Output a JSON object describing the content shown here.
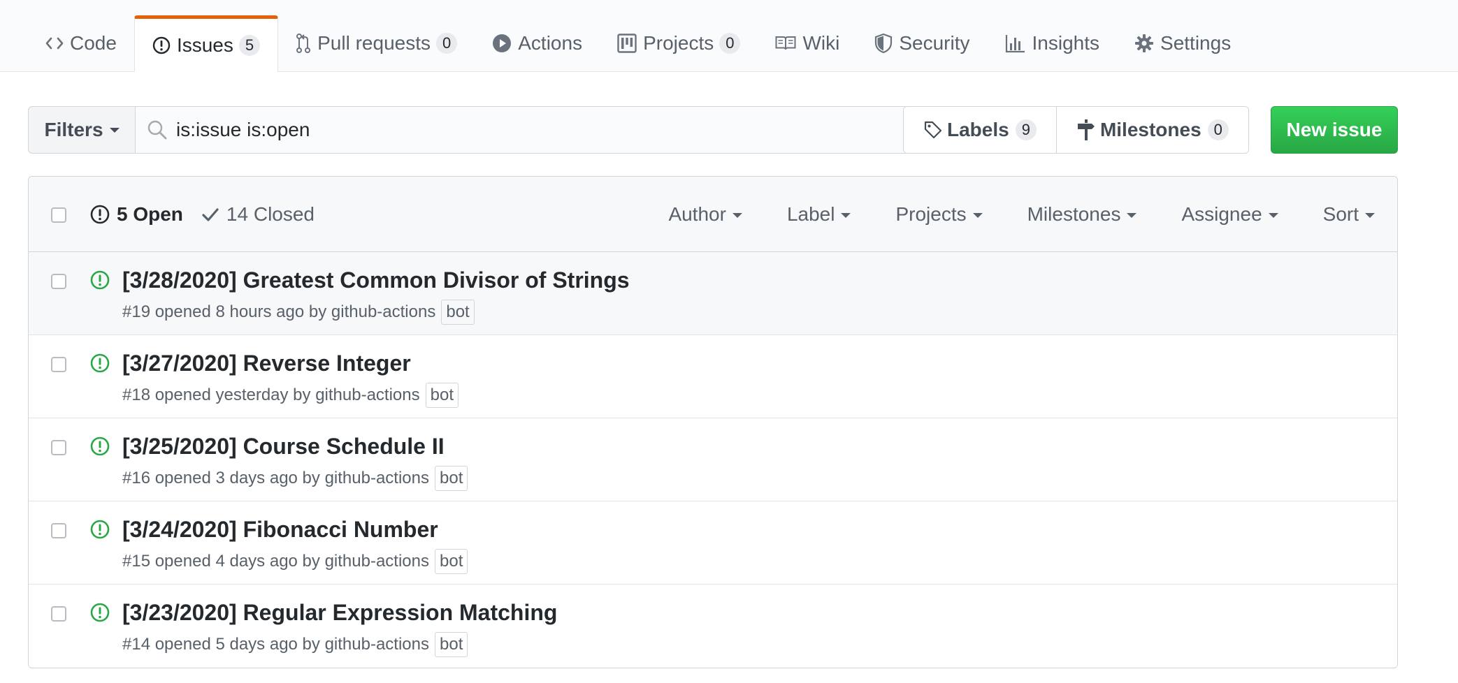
{
  "nav": {
    "tabs": [
      {
        "label": "Code",
        "icon": "code-icon",
        "count": null,
        "selected": false
      },
      {
        "label": "Issues",
        "icon": "issue-opened-icon",
        "count": "5",
        "selected": true
      },
      {
        "label": "Pull requests",
        "icon": "git-pull-request-icon",
        "count": "0",
        "selected": false
      },
      {
        "label": "Actions",
        "icon": "play-icon",
        "count": null,
        "selected": false
      },
      {
        "label": "Projects",
        "icon": "project-icon",
        "count": "0",
        "selected": false
      },
      {
        "label": "Wiki",
        "icon": "book-icon",
        "count": null,
        "selected": false
      },
      {
        "label": "Security",
        "icon": "shield-icon",
        "count": null,
        "selected": false
      },
      {
        "label": "Insights",
        "icon": "graph-icon",
        "count": null,
        "selected": false
      },
      {
        "label": "Settings",
        "icon": "gear-icon",
        "count": null,
        "selected": false
      }
    ]
  },
  "subnav": {
    "filters_label": "Filters",
    "search_value": "is:issue is:open",
    "labels_label": "Labels",
    "labels_count": "9",
    "milestones_label": "Milestones",
    "milestones_count": "0",
    "new_issue_label": "New issue"
  },
  "list": {
    "open_label": "5 Open",
    "closed_label": "14 Closed",
    "filters": [
      "Author",
      "Label",
      "Projects",
      "Milestones",
      "Assignee",
      "Sort"
    ],
    "issues": [
      {
        "title": "[3/28/2020] Greatest Common Divisor of Strings",
        "meta": "#19 opened 8 hours ago by github-actions",
        "badge": "bot"
      },
      {
        "title": "[3/27/2020] Reverse Integer",
        "meta": "#18 opened yesterday by github-actions",
        "badge": "bot"
      },
      {
        "title": "[3/25/2020] Course Schedule II",
        "meta": "#16 opened 3 days ago by github-actions",
        "badge": "bot"
      },
      {
        "title": "[3/24/2020] Fibonacci Number",
        "meta": "#15 opened 4 days ago by github-actions",
        "badge": "bot"
      },
      {
        "title": "[3/23/2020] Regular Expression Matching",
        "meta": "#14 opened 5 days ago by github-actions",
        "badge": "bot"
      }
    ]
  },
  "colors": {
    "accent_tab": "#e36209",
    "open_green": "#28a745",
    "new_issue_bg": "#2ea44f"
  }
}
